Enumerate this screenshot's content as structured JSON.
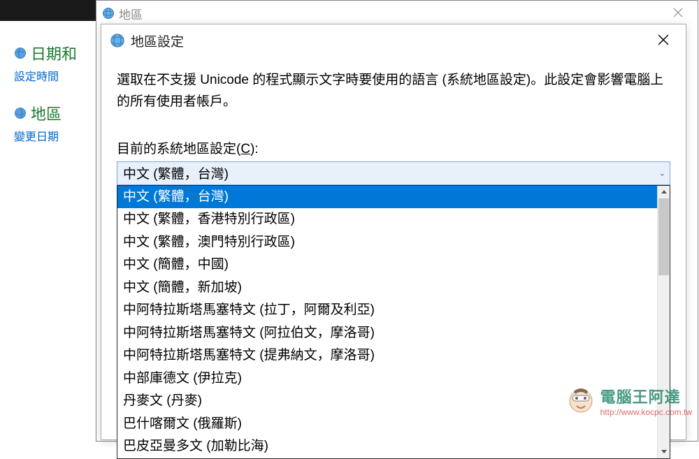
{
  "sidebar": {
    "items": [
      {
        "title": "日期和",
        "sub": "設定時間"
      },
      {
        "title": "地區",
        "sub": "變更日期"
      }
    ]
  },
  "outerWindow": {
    "title": "地區"
  },
  "innerWindow": {
    "title": "地區設定",
    "description": "選取在不支援 Unicode 的程式顯示文字時要使用的語言 (系統地區設定)。此設定會影響電腦上的所有使用者帳戶。",
    "label_prefix": "目前的系統地區設定(",
    "label_accelerator": "C",
    "label_suffix": "):"
  },
  "combo": {
    "selected": "中文 (繁體，台灣)"
  },
  "options": [
    "中文 (繁體，台灣)",
    "中文 (繁體，香港特別行政區)",
    "中文 (繁體，澳門特別行政區)",
    "中文 (簡體，中國)",
    "中文 (簡體，新加坡)",
    "中阿特拉斯塔馬塞特文 (拉丁，阿爾及利亞)",
    "中阿特拉斯塔馬塞特文 (阿拉伯文，摩洛哥)",
    "中阿特拉斯塔馬塞特文 (提弗納文，摩洛哥)",
    "中部庫德文 (伊拉克)",
    "丹麥文 (丹麥)",
    "巴什喀爾文 (俄羅斯)",
    "巴皮亞曼多文 (加勒比海)"
  ],
  "watermark": {
    "main": "電腦王阿達",
    "url": "http://www.kocpc.com.tw"
  }
}
